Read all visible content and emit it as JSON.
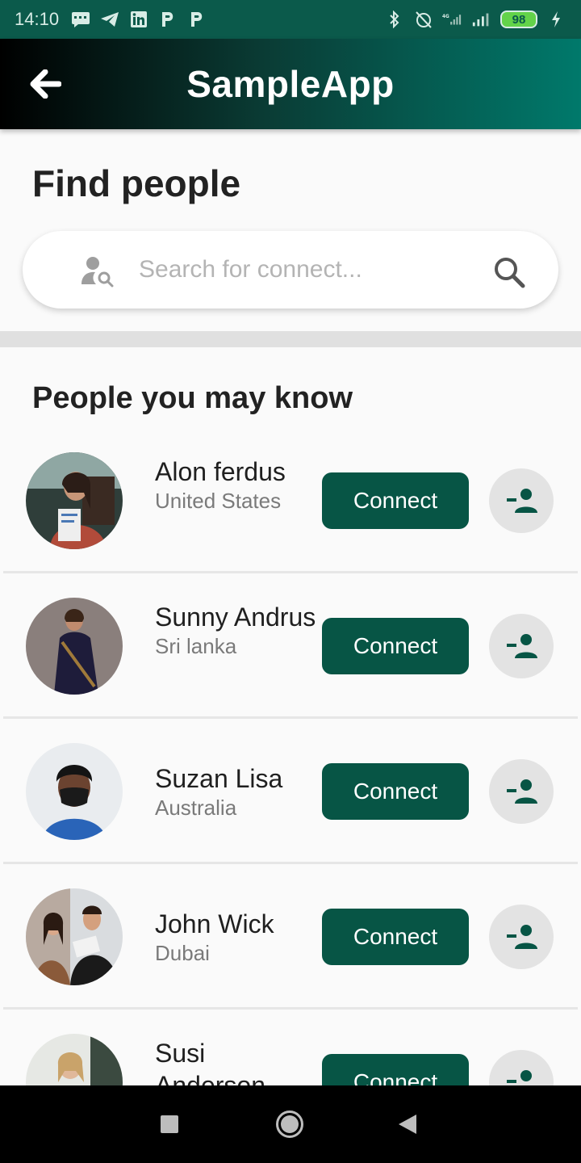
{
  "status_bar": {
    "time": "14:10",
    "battery": "98",
    "network": "4G"
  },
  "app_bar": {
    "title": "SampleApp"
  },
  "find": {
    "title": "Find people",
    "search_placeholder": "Search for connect..."
  },
  "section": {
    "title": "People you may know"
  },
  "people": [
    {
      "name": "Alon ferdus",
      "country": "United States",
      "action": "Connect"
    },
    {
      "name": "Sunny Andrus",
      "country": "Sri lanka",
      "action": "Connect"
    },
    {
      "name": "Suzan Lisa",
      "country": "Australia",
      "action": "Connect"
    },
    {
      "name": "John Wick",
      "country": "Dubai",
      "action": "Connect"
    },
    {
      "name": "Susi Anderson",
      "country": "",
      "action": "Connect"
    }
  ],
  "colors": {
    "accent": "#075545",
    "status_bar": "#0b5a4b",
    "app_bar_end": "#00796b"
  }
}
